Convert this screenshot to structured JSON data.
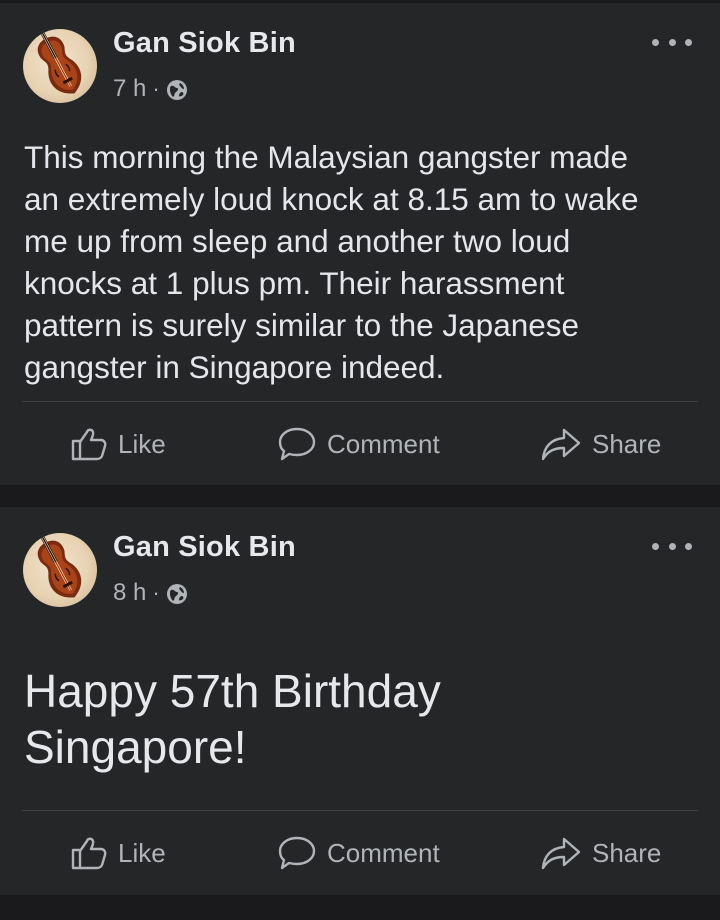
{
  "posts": [
    {
      "author": "Gan Siok Bin",
      "time": "7 h",
      "separator": "·",
      "privacy_icon": "globe-icon",
      "text": "This morning the Malaysian gangster made\nan extremely loud knock at 8.15 am to wake\nme up from sleep and another two loud\nknocks at 1 plus pm. Their harassment\npattern is surely similar to the Japanese\ngangster in Singapore indeed.",
      "actions": {
        "like": "Like",
        "comment": "Comment",
        "share": "Share"
      }
    },
    {
      "author": "Gan Siok Bin",
      "time": "8 h",
      "separator": "·",
      "privacy_icon": "globe-icon",
      "text": "Happy 57th Birthday\nSingapore!",
      "actions": {
        "like": "Like",
        "comment": "Comment",
        "share": "Share"
      }
    }
  ],
  "colors": {
    "background": "#1a1a1c",
    "card": "#252628",
    "primary_text": "#e4e6eb",
    "secondary_text": "#b0b3b8",
    "divider": "#3e4042"
  }
}
